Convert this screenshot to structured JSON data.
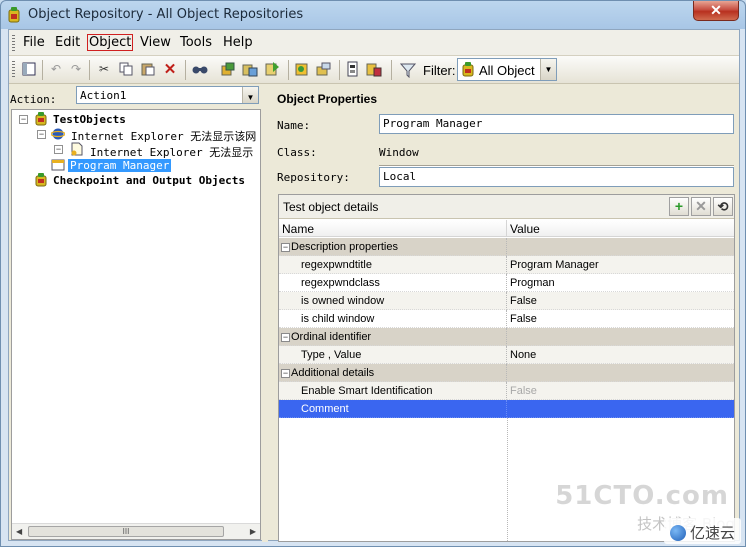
{
  "window": {
    "title": "Object Repository - All Object Repositories",
    "close_glyph": "✕"
  },
  "menu": {
    "items": [
      "File",
      "Edit",
      "Object",
      "View",
      "Tools",
      "Help"
    ]
  },
  "toolbar": {
    "buttons": [
      "view-icon",
      "undo-icon",
      "redo-icon",
      "cut-icon",
      "copy-icon",
      "paste-icon",
      "delete-icon",
      "find-icon",
      "add-objects-icon",
      "localize-icon",
      "export-icon",
      "object-spy-icon",
      "highlight-icon",
      "update-icon",
      "associate-icon"
    ],
    "filter_label": "Filter:",
    "filter_value": "All Object"
  },
  "left": {
    "action_label": "Action:",
    "action_value": "Action1",
    "tree": [
      {
        "label": "TestObjects",
        "bold": true
      },
      {
        "label": "Internet  Explorer  无法显示该网"
      },
      {
        "label": "Internet  Explorer  无法显示"
      },
      {
        "label": "Program Manager",
        "selected": true
      },
      {
        "label": "Checkpoint and Output Objects",
        "bold": true
      }
    ],
    "scroll_thumb_glyph": "III"
  },
  "properties": {
    "title": "Object Properties",
    "name_label": "Name:",
    "name_value": "Program Manager",
    "class_label": "Class:",
    "class_value": "Window",
    "repo_label": "Repository:",
    "repo_value": "Local"
  },
  "details": {
    "title": "Test object details",
    "col_name": "Name",
    "col_value": "Value",
    "rows": [
      {
        "name": "Description properties",
        "value": "",
        "group": true
      },
      {
        "name": "regexpwndtitle",
        "value": "Program Manager"
      },
      {
        "name": "regexpwndclass",
        "value": "Progman"
      },
      {
        "name": "is owned window",
        "value": "False"
      },
      {
        "name": "is child window",
        "value": "False"
      },
      {
        "name": "Ordinal identifier",
        "value": "",
        "group": true
      },
      {
        "name": "Type , Value",
        "value": "None"
      },
      {
        "name": "Additional details",
        "value": "",
        "group": true
      },
      {
        "name": "Enable Smart Identification",
        "value": "False",
        "disabled": true
      },
      {
        "name": "Comment",
        "value": "",
        "selected": true
      }
    ]
  },
  "watermark": {
    "text1": "51CTO.com",
    "text2": "技术博客  Blog",
    "brand": "亿速云"
  }
}
